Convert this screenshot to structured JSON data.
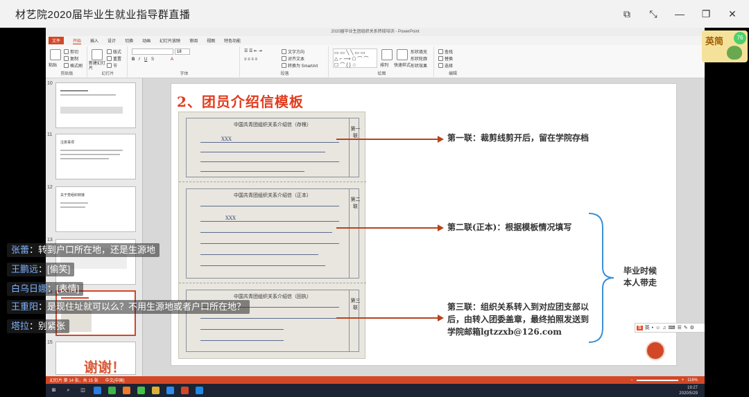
{
  "window": {
    "title": "材艺院2020届毕业生就业指导群直播"
  },
  "ppt": {
    "title": "2020届毕业生团组织关系转接培训 - PowerPoint",
    "tabs": [
      "文件",
      "开始",
      "插入",
      "设计",
      "切换",
      "动画",
      "幻灯片放映",
      "审阅",
      "视图",
      "特色功能"
    ],
    "ribbon": {
      "clipboard": {
        "label": "剪贴板",
        "paste": "粘贴",
        "cut": "剪切",
        "copy": "复制",
        "format_painter": "格式刷"
      },
      "slides": {
        "label": "幻灯片",
        "new_slide": "新建幻灯片",
        "layout": "版式",
        "reset": "重置",
        "section": "节"
      },
      "font": {
        "label": "字体",
        "size": "18"
      },
      "paragraph": {
        "label": "段落",
        "text_direction": "文字方向",
        "align_text": "对齐文本",
        "smartart": "转换为 SmartArt"
      },
      "drawing": {
        "label": "绘图",
        "arrange": "排列",
        "quick_styles": "快速样式",
        "shape_fill": "形状填充",
        "shape_outline": "形状轮廓",
        "shape_effects": "形状效果"
      },
      "editing": {
        "label": "编辑",
        "find": "查找",
        "replace": "替换",
        "select": "选择"
      }
    },
    "thumbnails": [
      {
        "num": "10",
        "title": ""
      },
      {
        "num": "11",
        "title": "注意事项"
      },
      {
        "num": "12",
        "title": "关于党组织转接"
      },
      {
        "num": "13",
        "title": ""
      },
      {
        "num": "14",
        "title": ""
      },
      {
        "num": "15",
        "title": "谢谢！"
      }
    ],
    "status": {
      "slide_count": "幻灯片 第 14 张，共 15 张",
      "language": "中文(中国)",
      "zoom": "116%"
    },
    "clock": {
      "time": "19:27",
      "date": "2020/5/29"
    }
  },
  "slide": {
    "title": "2、团员介绍信模板",
    "form": {
      "section1_head": "中国共青团组织关系介绍信（存根）",
      "section2_head": "中国共青团组织关系介绍信（正本）",
      "section3_head": "中国共青团组织关系介绍信（回执）",
      "tag1": "第一联",
      "tag2": "第二联",
      "tag3": "第三联",
      "placeholder_name": "XXX"
    },
    "notes": {
      "first": "第一联：裁剪线剪开后，留在学院存档",
      "second": "第二联(正本)：根据模板情况填写",
      "third_1": "第三联：组织关系转入到对应团支部以",
      "third_2": "后，由转入团委盖章，最终拍照发送到",
      "third_3": "学院邮箱lgtzzxb@126.com"
    },
    "brace_text_1": "毕业时候",
    "brace_text_2": "本人带走"
  },
  "ime": {
    "logo": "S",
    "items": [
      "英",
      "•",
      "☺",
      "♫",
      "⌨",
      "☰",
      "✎",
      "⚙"
    ]
  },
  "comments": [
    {
      "who": "张蕾",
      "msg": "转到户口所在地，还是生源地"
    },
    {
      "who": "王鹏远",
      "msg": "[偷笑]"
    },
    {
      "who": "白乌日娜",
      "msg": "[表情]"
    },
    {
      "who": "王重阳",
      "msg": "是现住址就可以么？不用生源地或者户口所在地？"
    },
    {
      "who": "塔拉",
      "msg": "别紧张"
    }
  ],
  "avatar": {
    "text": "英简",
    "badge": "76"
  },
  "colors": {
    "accent": "#d24726",
    "slide_title": "#e03c1e",
    "arrow": "#b8421c",
    "comment_name": "#7fb3ff"
  }
}
